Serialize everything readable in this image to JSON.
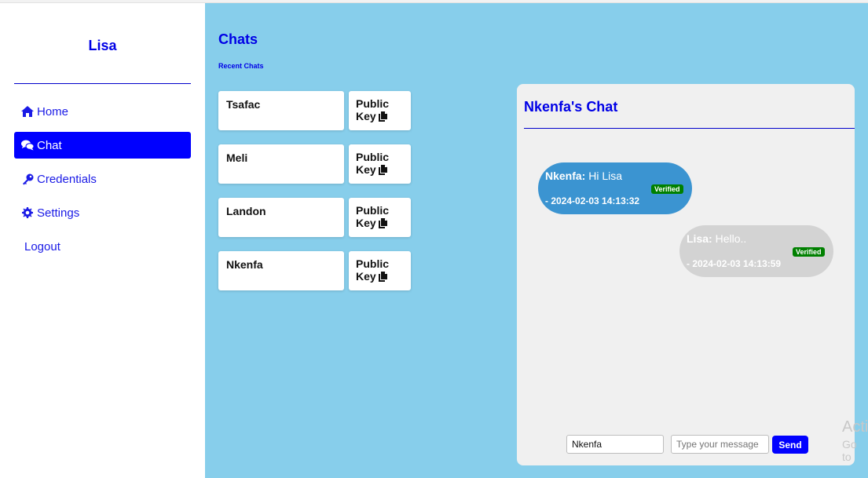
{
  "sidebar": {
    "user_name": "Lisa",
    "items": [
      {
        "label": "Home",
        "icon": "home-icon"
      },
      {
        "label": "Chat",
        "icon": "chat-icon",
        "active": true
      },
      {
        "label": "Credentials",
        "icon": "key-icon"
      },
      {
        "label": "Settings",
        "icon": "gear-icon"
      },
      {
        "label": "Logout"
      }
    ]
  },
  "main": {
    "title": "Chats",
    "subtitle": "Recent Chats",
    "contacts": [
      {
        "name": "Tsafac",
        "key_label": "Public Key"
      },
      {
        "name": "Meli",
        "key_label": "Public Key"
      },
      {
        "name": "Landon",
        "key_label": "Public Key"
      },
      {
        "name": "Nkenfa",
        "key_label": "Public Key"
      }
    ]
  },
  "chat": {
    "title": "Nkenfa's Chat",
    "messages": [
      {
        "sender": "Nkenfa:",
        "text": " Hi Lisa",
        "badge": "Verified",
        "time": "- 2024-02-03 14:13:32",
        "direction": "incoming"
      },
      {
        "sender": "Lisa:",
        "text": " Hello..",
        "badge": "Verified",
        "time": "- 2024-02-03 14:13:59",
        "direction": "outgoing"
      }
    ],
    "composer": {
      "recipient_value": "Nkenfa",
      "message_placeholder": "Type your message",
      "send_label": "Send"
    }
  },
  "colors": {
    "accent": "#0000ff",
    "main_bg": "#87ceeb",
    "incoming_bubble": "#3b94d1",
    "outgoing_bubble": "#d3d3d3",
    "verified": "#008000"
  },
  "watermark": {
    "line1": "Acti",
    "line2": "Go to"
  }
}
